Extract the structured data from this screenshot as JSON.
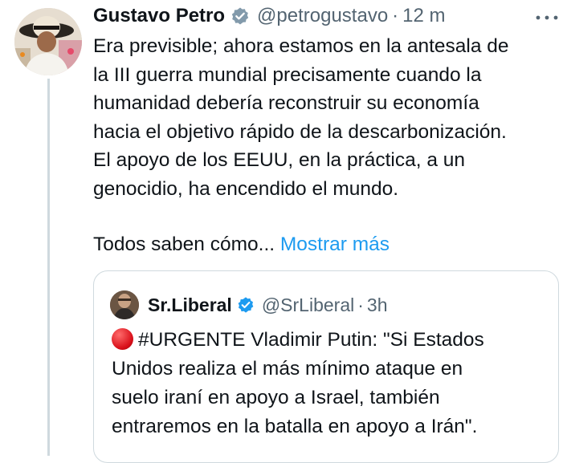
{
  "tweet": {
    "author_name": "Gustavo Petro",
    "author_handle": "@petrogustavo",
    "separator": "·",
    "time": "12 m",
    "text": "Era previsible; ahora estamos en la antesala de\nla III guerra mundial precisamente cuando la\nhumanidad debería reconstruir su economía\nhacia el objetivo rápido de la descarbonización.\nEl apoyo de los EEUU, en la práctica, a un\ngenocidio, ha encendido el mundo.",
    "truncated_text": "Todos saben cómo...",
    "show_more_label": "Mostrar más",
    "verified_icon": "verified-badge-icon",
    "more_icon": "more-options-icon"
  },
  "quoted_tweet": {
    "author_name": "Sr.Liberal",
    "author_handle": "@SrLiberal",
    "separator": "·",
    "time": "3h",
    "emoji_icon": "red-circle-icon",
    "text": "#URGENTE Vladimir Putin:  \"Si Estados\nUnidos realiza el más mínimo ataque en\nsuelo iraní en apoyo a Israel, también\nentraremos en la batalla en apoyo a Irán\"."
  },
  "colors": {
    "text": "#0f1419",
    "secondary": "#536471",
    "link": "#1d9bf0",
    "verified": "#829aab",
    "border": "#cfd9de"
  }
}
